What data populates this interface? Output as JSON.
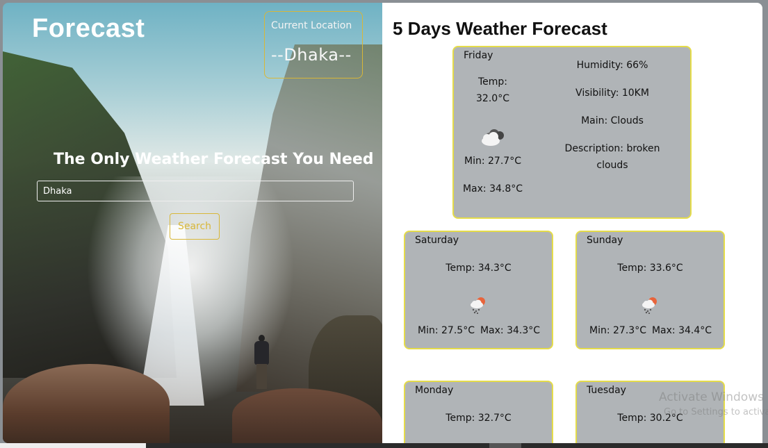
{
  "header": {
    "brand": "Forecast",
    "location_label": "Current Location",
    "location_value": "--Dhaka--"
  },
  "hero": {
    "tagline": "The Only Weather Forecast You Need",
    "search_value": "Dhaka",
    "search_button": "Search"
  },
  "forecast": {
    "title": "5 Days Weather Forecast",
    "main_day": {
      "day": "Friday",
      "temp_label": "Temp:",
      "temp_value": "32.0°C",
      "icon": "broken-clouds-icon",
      "min": "Min: 27.7°C",
      "max": "Max: 34.8°C",
      "humidity": "Humidity: 66%",
      "visibility": "Visibility: 10KM",
      "main": "Main: Clouds",
      "description_line1": "Description: broken",
      "description_line2": "clouds"
    },
    "days": [
      {
        "day": "Saturday",
        "temp": "Temp: 34.3°C",
        "icon": "rain-sun-icon",
        "min": "Min: 27.5°C",
        "max": "Max: 34.3°C"
      },
      {
        "day": "Sunday",
        "temp": "Temp: 33.6°C",
        "icon": "rain-sun-icon",
        "min": "Min: 27.3°C",
        "max": "Max: 34.4°C"
      },
      {
        "day": "Monday",
        "temp": "Temp: 32.7°C"
      },
      {
        "day": "Tuesday",
        "temp": "Temp: 30.2°C"
      }
    ]
  },
  "overlay": {
    "watermark_title": "Activate Windows",
    "watermark_sub": "Go to Settings to activate"
  },
  "colors": {
    "accent": "#e5dc49",
    "card_bg": "#b0b4b7",
    "button_border": "#d8b738"
  }
}
